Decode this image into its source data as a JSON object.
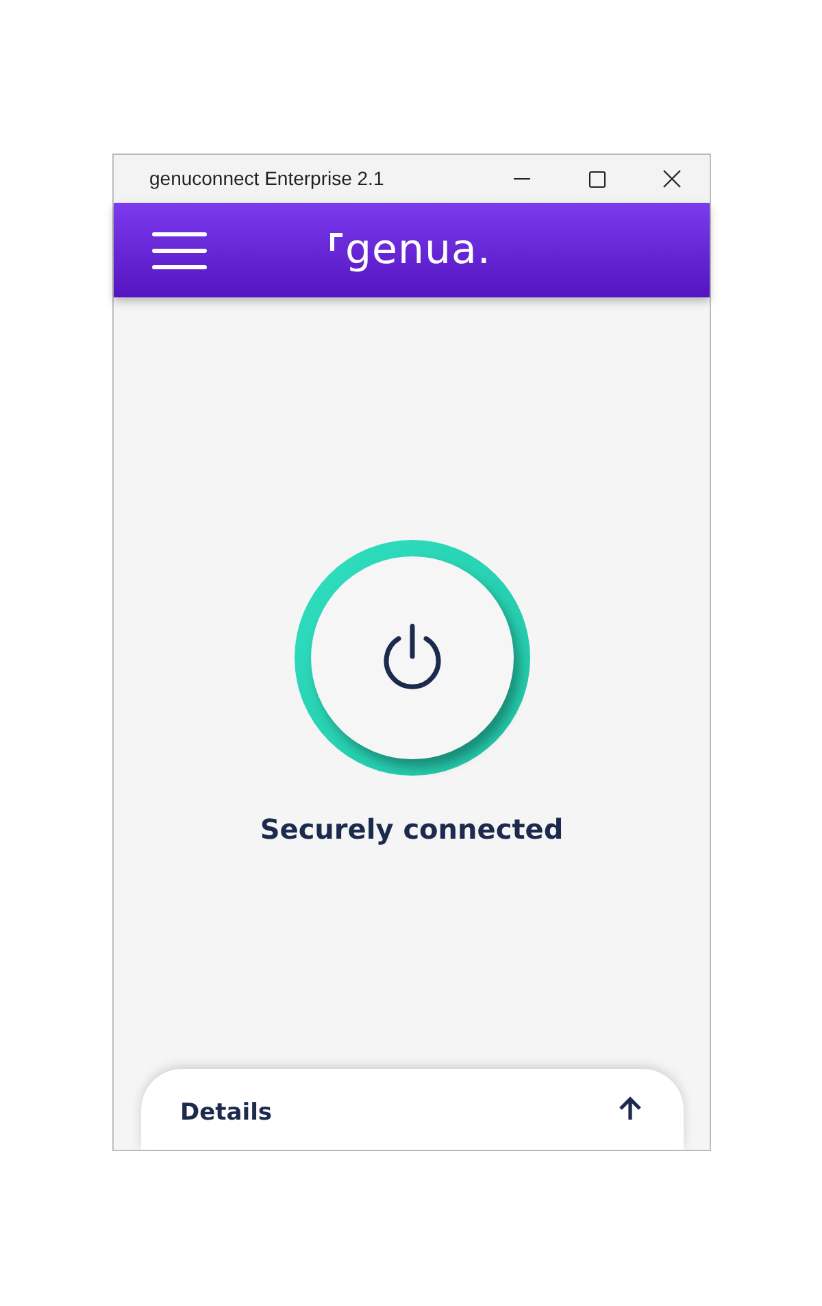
{
  "window": {
    "title": "genuconnect Enterprise 2.1"
  },
  "header": {
    "logo": "genua."
  },
  "connection": {
    "connected": true,
    "status": "Securely connected"
  },
  "details": {
    "label": "Details",
    "expanded": false
  }
}
